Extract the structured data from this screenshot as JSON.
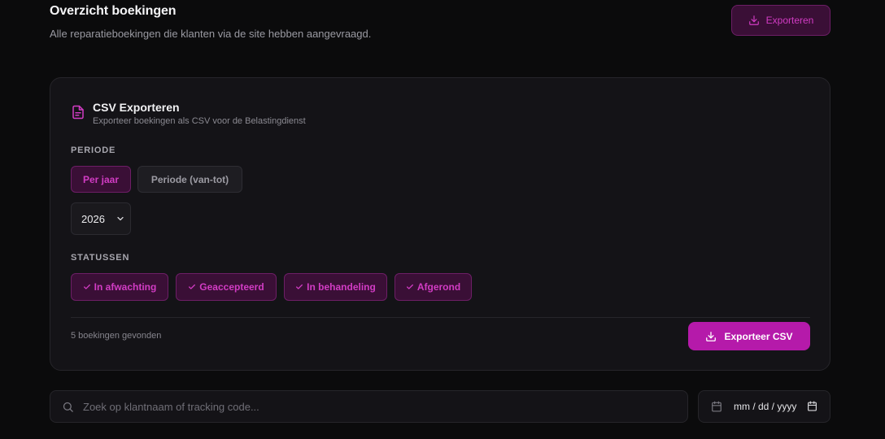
{
  "header": {
    "title": "Overzicht boekingen",
    "subtitle": "Alle reparatieboekingen die klanten via de site hebben aangevraagd.",
    "export_label": "Exporteren"
  },
  "csv_card": {
    "title": "CSV Exporteren",
    "description": "Exporteer boekingen als CSV voor de Belastingdienst",
    "period_label": "PERIODE",
    "period_options": [
      {
        "label": "Per jaar",
        "active": true
      },
      {
        "label": "Periode (van-tot)",
        "active": false
      }
    ],
    "year": "2026",
    "status_label": "STATUSSEN",
    "statuses": [
      {
        "label": "In afwachting",
        "checked": true
      },
      {
        "label": "Geaccepteerd",
        "checked": true
      },
      {
        "label": "In behandeling",
        "checked": true
      },
      {
        "label": "Afgerond",
        "checked": true
      }
    ],
    "found_text": "5 boekingen gevonden",
    "export_button": "Exporteer CSV"
  },
  "filters": {
    "search_placeholder": "Zoek op klantnaam of tracking code...",
    "date_placeholder": "mm / dd / yyyy"
  },
  "colors": {
    "accent": "#b51aaa",
    "accent_text": "#d23cc4",
    "background": "#0b0b0c",
    "card": "#141317"
  },
  "icons": [
    "download-icon",
    "file-text-icon",
    "chevron-down-icon",
    "check-icon",
    "search-icon",
    "calendar-icon"
  ]
}
